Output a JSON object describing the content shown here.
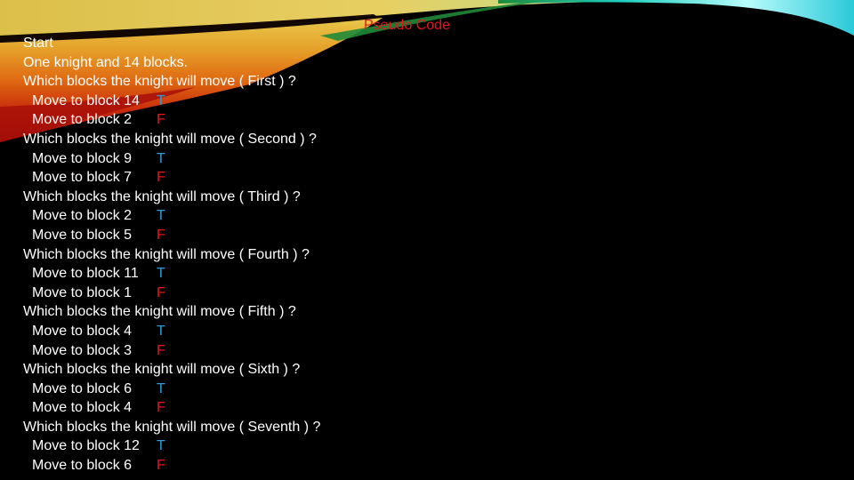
{
  "slide": {
    "title": "Pseudo Code",
    "colors": {
      "background": "#000000",
      "text": "#ffffff",
      "title": "#e0191b",
      "true_mark": "#2a9fd6",
      "false_mark": "#e0191b"
    },
    "lines": [
      {
        "text": "Start",
        "indent": false,
        "mark": ""
      },
      {
        "text": "One knight and 14 blocks.",
        "indent": false,
        "mark": ""
      },
      {
        "text": "Which blocks the knight will move ( First ) ?",
        "indent": false,
        "mark": ""
      },
      {
        "text": "Move to block 14",
        "indent": true,
        "mark": "T"
      },
      {
        "text": "Move to block 2",
        "indent": true,
        "mark": "F"
      },
      {
        "text": "Which blocks the knight will move ( Second ) ?",
        "indent": false,
        "mark": ""
      },
      {
        "text": "Move to block 9",
        "indent": true,
        "mark": "T"
      },
      {
        "text": "Move to block 7",
        "indent": true,
        "mark": "F"
      },
      {
        "text": "Which blocks the knight will move ( Third ) ?",
        "indent": false,
        "mark": ""
      },
      {
        "text": "Move to block 2",
        "indent": true,
        "mark": "T"
      },
      {
        "text": "Move to block 5",
        "indent": true,
        "mark": "F"
      },
      {
        "text": "Which blocks the knight will move ( Fourth ) ?",
        "indent": false,
        "mark": ""
      },
      {
        "text": "Move to block 11",
        "indent": true,
        "mark": "T"
      },
      {
        "text": "Move to block 1",
        "indent": true,
        "mark": "F"
      },
      {
        "text": "Which blocks the knight will move ( Fifth ) ?",
        "indent": false,
        "mark": ""
      },
      {
        "text": "Move to block 4",
        "indent": true,
        "mark": "T"
      },
      {
        "text": "Move to block 3",
        "indent": true,
        "mark": "F"
      },
      {
        "text": "Which blocks the knight will move ( Sixth ) ?",
        "indent": false,
        "mark": ""
      },
      {
        "text": "Move to block 6",
        "indent": true,
        "mark": "T"
      },
      {
        "text": "Move to block 4",
        "indent": true,
        "mark": "F"
      },
      {
        "text": "Which blocks the knight will move ( Seventh ) ?",
        "indent": false,
        "mark": ""
      },
      {
        "text": "Move to block 12",
        "indent": true,
        "mark": "T"
      },
      {
        "text": "Move to block 6",
        "indent": true,
        "mark": "F"
      }
    ]
  }
}
